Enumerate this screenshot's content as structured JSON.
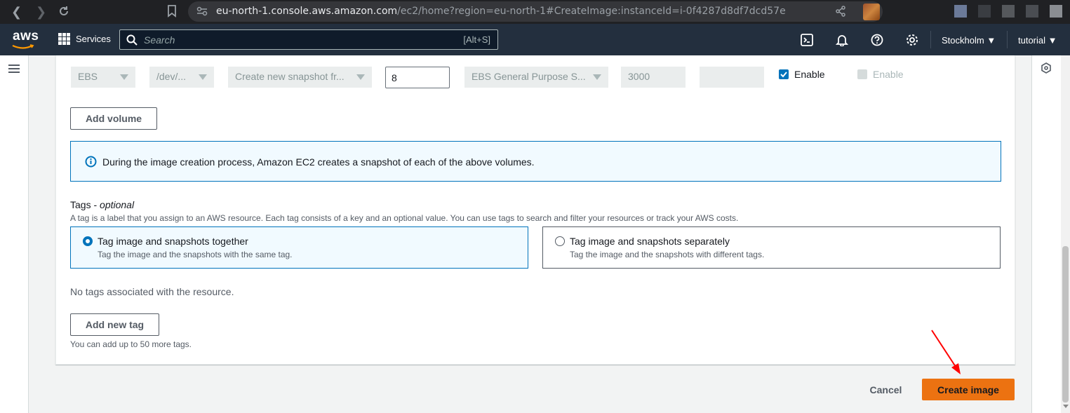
{
  "browser": {
    "url_host": "eu-north-1.console.aws.amazon.com",
    "url_path": "/ec2/home?region=eu-north-1#CreateImage:instanceId=i-0f4287d8df7dcd57e"
  },
  "header": {
    "logo": "aws",
    "services_label": "Services",
    "search_placeholder": "Search",
    "search_shortcut": "[Alt+S]",
    "region": "Stockholm",
    "user": "tutorial"
  },
  "volume_row": {
    "volume_type": "EBS",
    "device": "/dev/...",
    "snapshot": "Create new snapshot fr...",
    "size": "8",
    "ebs_type": "EBS General Purpose S...",
    "iops": "3000",
    "throughput": "",
    "delete_on_termination": {
      "label": "Enable",
      "checked": true
    },
    "encrypted": {
      "label": "Enable",
      "checked": false,
      "disabled": true
    }
  },
  "add_volume_label": "Add volume",
  "info_message": "During the image creation process, Amazon EC2 creates a snapshot of each of the above volumes.",
  "tags": {
    "label": "Tags",
    "optional": "optional",
    "description": "A tag is a label that you assign to an AWS resource. Each tag consists of a key and an optional value. You can use tags to search and filter your resources or track your AWS costs.",
    "options": [
      {
        "title": "Tag image and snapshots together",
        "subtitle": "Tag the image and the snapshots with the same tag.",
        "selected": true
      },
      {
        "title": "Tag image and snapshots separately",
        "subtitle": "Tag the image and the snapshots with different tags.",
        "selected": false
      }
    ],
    "empty_message": "No tags associated with the resource.",
    "add_label": "Add new tag",
    "limit_hint": "You can add up to 50 more tags."
  },
  "actions": {
    "cancel_label": "Cancel",
    "create_label": "Create image"
  },
  "colors": {
    "primary_button": "#ec7211",
    "selection_blue": "#0073bb",
    "header_bg": "#232f3e",
    "annotation_arrow": "#ff0000"
  }
}
